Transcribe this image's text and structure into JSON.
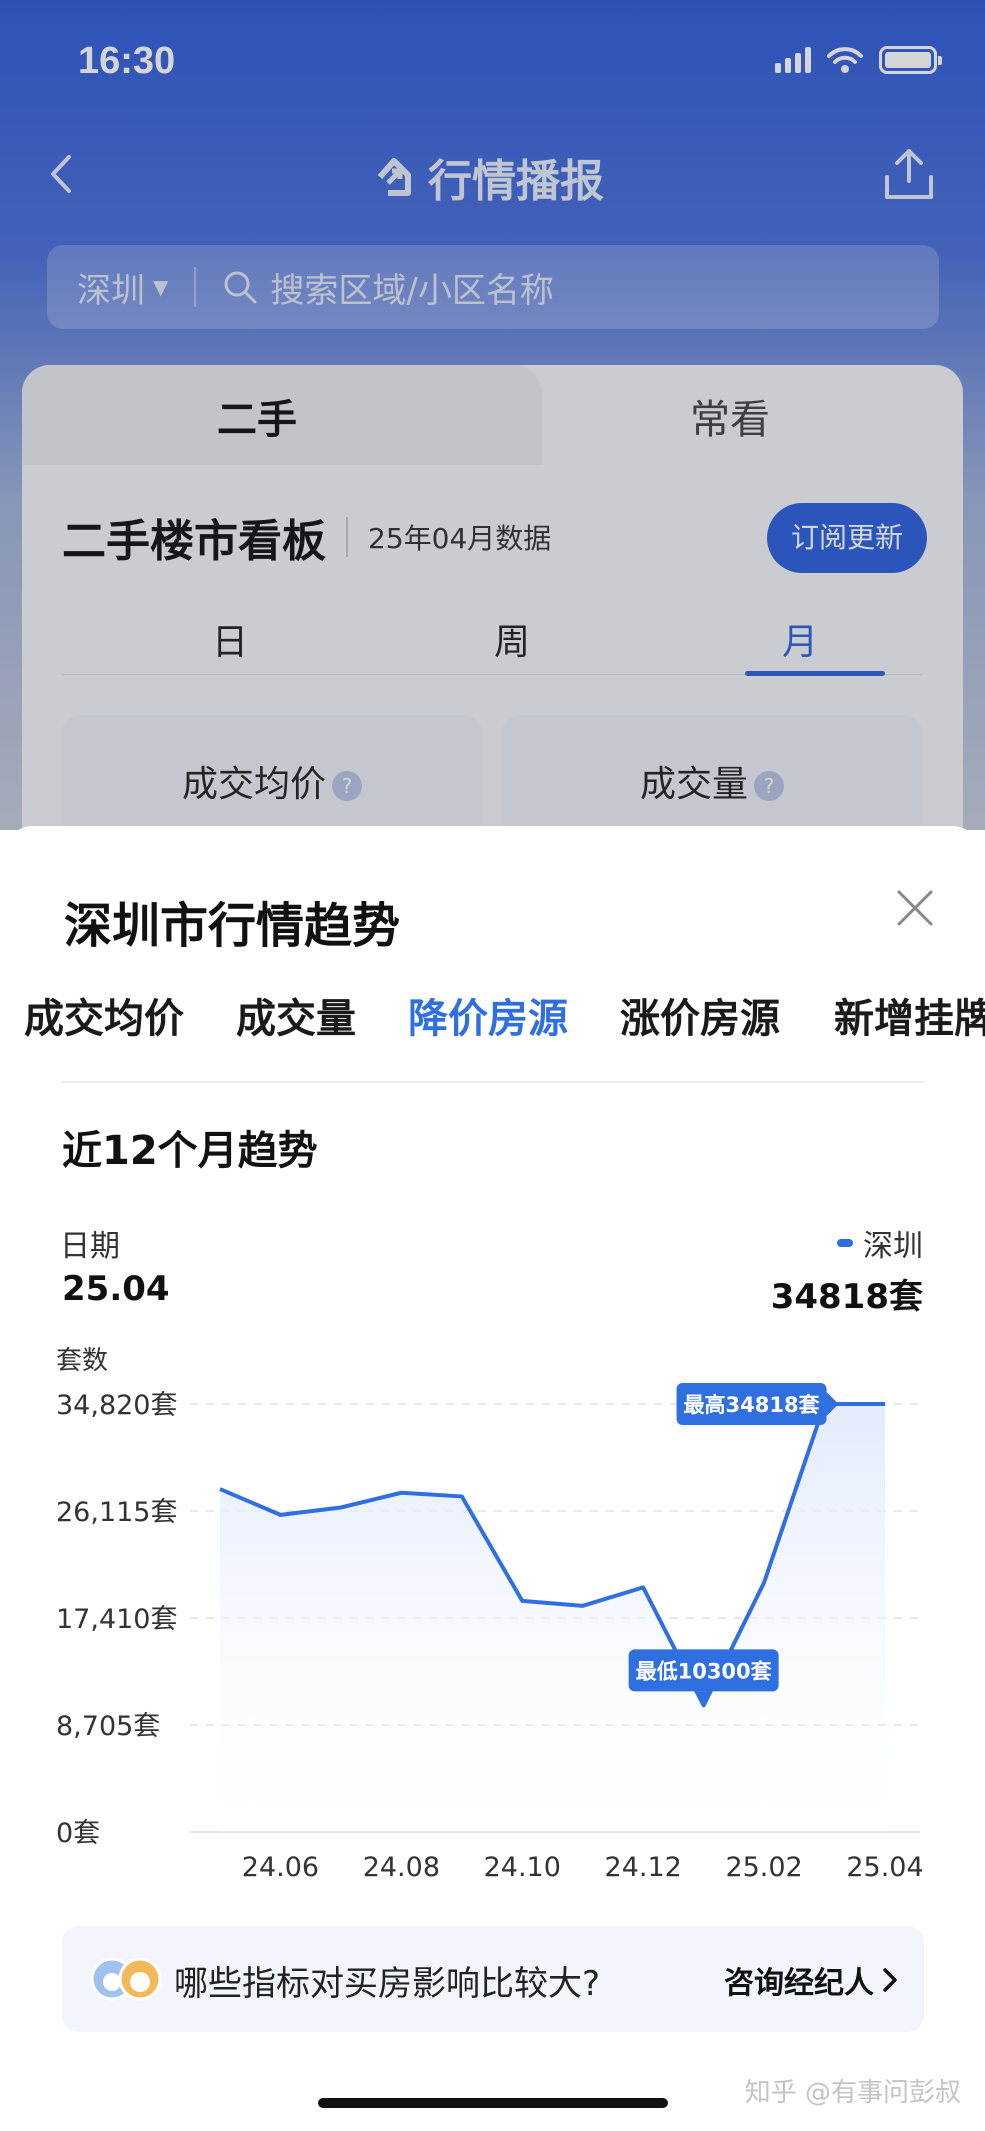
{
  "status": {
    "time": "16:30"
  },
  "nav": {
    "title": "行情播报"
  },
  "search": {
    "city": "深圳",
    "placeholder": "搜索区域/小区名称"
  },
  "card": {
    "tabs": [
      "二手",
      "常看"
    ],
    "title": "二手楼市看板",
    "subtitle": "25年04月数据",
    "subscribe_label": "订阅更新",
    "periods": [
      "日",
      "周",
      "月"
    ],
    "active_period": "月",
    "stats": [
      {
        "label": "成交均价"
      },
      {
        "label": "成交量"
      }
    ]
  },
  "sheet": {
    "title": "深圳市行情趋势",
    "metric_tabs": [
      "成交均价",
      "成交量",
      "降价房源",
      "涨价房源",
      "新增挂牌"
    ],
    "active_metric": "降价房源",
    "section_title": "近12个月趋势",
    "date_label": "日期",
    "date_value": "25.04",
    "legend_label": "深圳",
    "metric_value": "34818套",
    "y_unit_label": "套数"
  },
  "chart_data": {
    "type": "area",
    "ylabel": "套数",
    "ylim": [
      0,
      34820
    ],
    "y_ticks": [
      "34,820套",
      "26,115套",
      "17,410套",
      "8,705套",
      "0套"
    ],
    "x_ticks": [
      "24.06",
      "24.08",
      "24.10",
      "24.12",
      "25.02",
      "25.04"
    ],
    "x": [
      "24.05",
      "24.06",
      "24.07",
      "24.08",
      "24.09",
      "24.10",
      "24.11",
      "24.12",
      "25.01",
      "25.02",
      "25.03",
      "25.04"
    ],
    "series": [
      {
        "name": "深圳",
        "color": "#2f6fe0",
        "values": [
          27900,
          25800,
          26400,
          27600,
          27300,
          18800,
          18400,
          19900,
          10300,
          20300,
          34818,
          34818
        ]
      }
    ],
    "annotations": {
      "max_label": "最高34818套",
      "min_label": "最低10300套"
    },
    "grid": true
  },
  "tip": {
    "text": "哪些指标对买房影响比较大?",
    "action_label": "咨询经纪人"
  },
  "watermark": "知乎 @有事问彭叔"
}
